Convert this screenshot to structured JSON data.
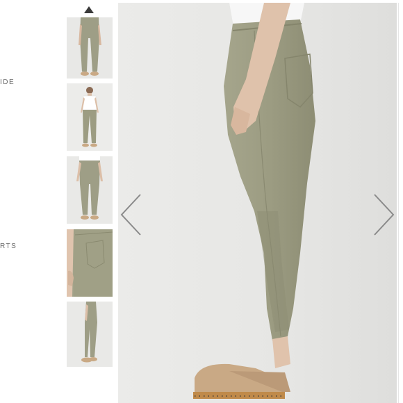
{
  "sidebar": {
    "labels": [
      "IDE",
      "RTS"
    ]
  },
  "gallery": {
    "thumbnail_count": 5,
    "selected_index": 0
  },
  "icons": {
    "scroll_up": "triangle-up-icon",
    "prev": "chevron-left-icon",
    "next": "chevron-right-icon"
  },
  "colors": {
    "pants": "#9c9c82",
    "background": "#e9e9e7",
    "clog": "#c9a985",
    "arrow": "#8a8a8a"
  }
}
